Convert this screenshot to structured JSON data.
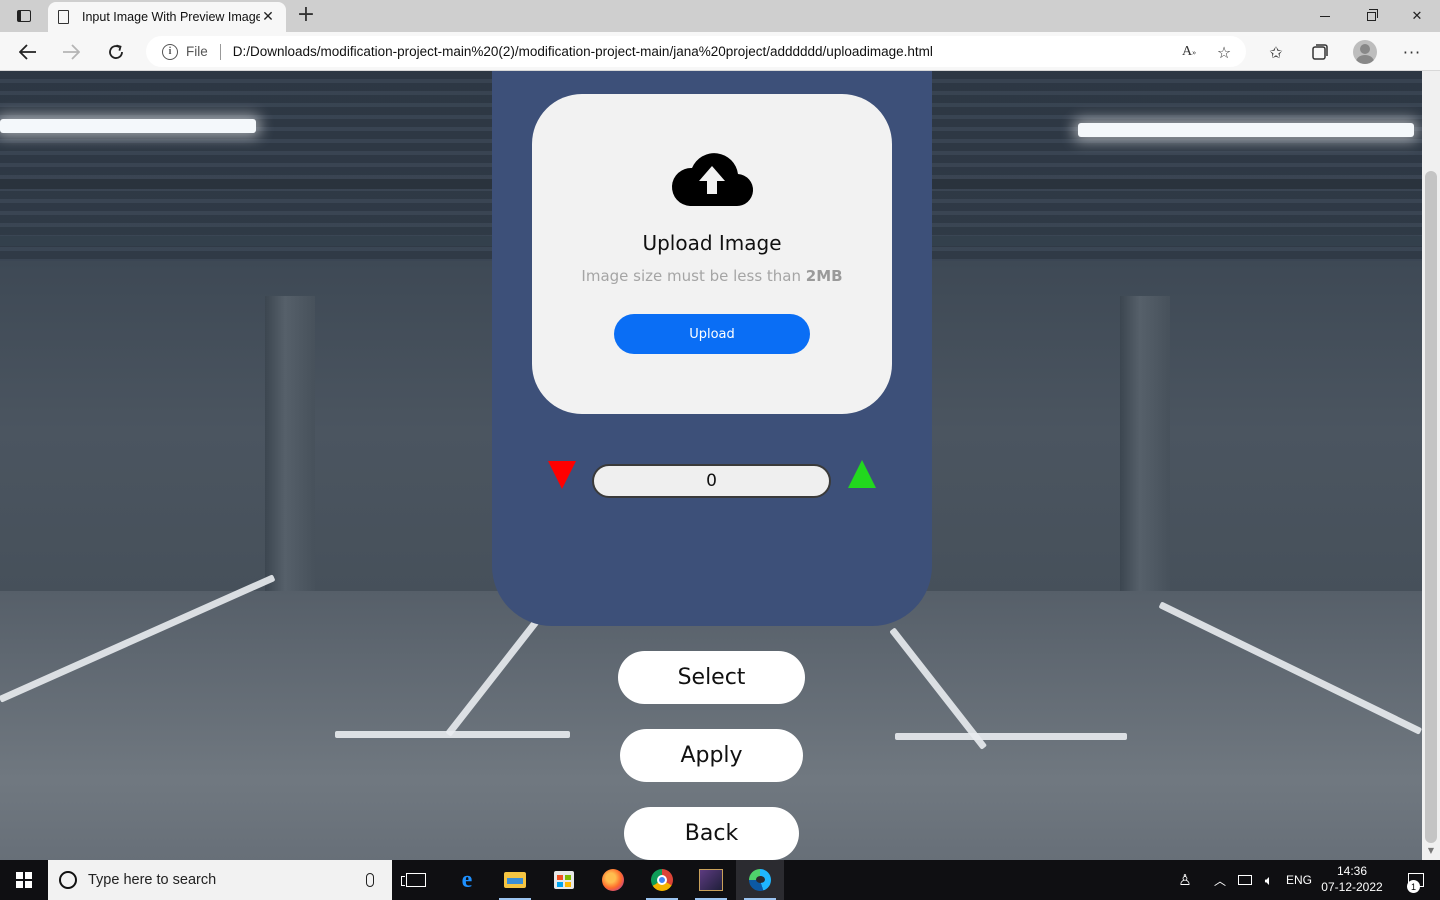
{
  "browser": {
    "tab_title": "Input Image With Preview Image",
    "tab_close": "✕",
    "new_tab": "+",
    "url_scheme_label": "File",
    "url": "D:/Downloads/modification-project-main%20(2)/modification-project-main/jana%20project/adddddd/uploadimage.html",
    "icons": [
      "tab-actions-icon",
      "page-icon",
      "back-icon",
      "forward-icon",
      "reload-icon",
      "info-icon",
      "read-aloud-icon",
      "add-favorite-icon",
      "favorites-icon",
      "collections-icon",
      "profile-icon",
      "more-icon"
    ]
  },
  "upload_card": {
    "title": "Upload Image",
    "hint_prefix": "Image size must be less than ",
    "hint_bold": "2MB",
    "button_label": "Upload",
    "icon": "cloud-upload-icon"
  },
  "counter": {
    "value": "0",
    "decrement_color": "#ff0000",
    "increment_color": "#22d81e"
  },
  "actions": {
    "select_label": "Select",
    "apply_label": "Apply",
    "back_label": "Back"
  },
  "colors": {
    "panel": "#3d5079",
    "card": "#f2f2f2",
    "upload_button": "#0a6ef5"
  },
  "taskbar": {
    "search_placeholder": "Type here to search",
    "language": "ENG",
    "time": "14:36",
    "date": "07-12-2022",
    "notification_count": "1",
    "apps": [
      "task-view-icon",
      "edge-legacy-icon",
      "file-explorer-icon",
      "store-icon",
      "firefox-icon",
      "chrome-icon",
      "game-icon",
      "edge-icon"
    ]
  }
}
